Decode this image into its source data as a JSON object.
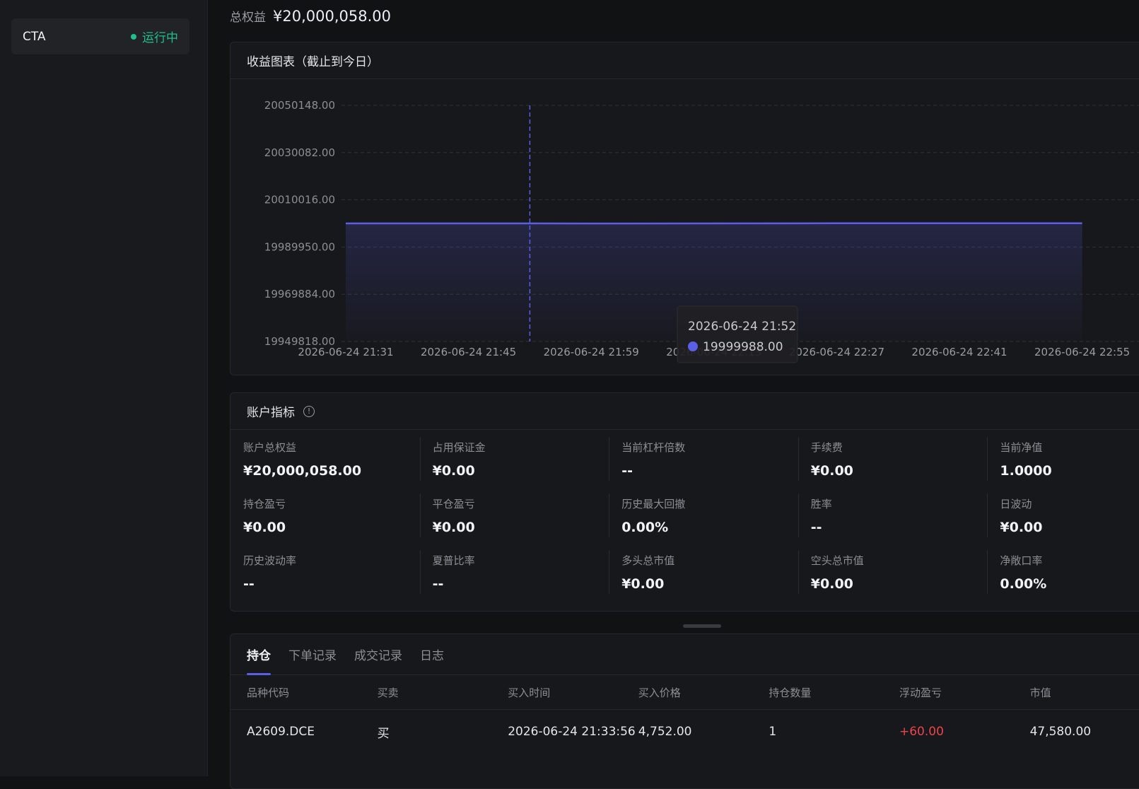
{
  "sidebar": {
    "strategy": {
      "name": "CTA",
      "status": "运行中",
      "status_color": "#1fbf8f"
    }
  },
  "header": {
    "equity_label": "总权益",
    "equity_value": "¥20,000,058.00"
  },
  "chart_card": {
    "title": "收益图表（截止到今日）",
    "chart_data": {
      "type": "area",
      "x": [
        "2026-06-24 21:31",
        "2026-06-24 21:45",
        "2026-06-24 21:59",
        "2026-06-24 22:13",
        "2026-06-24 22:27",
        "2026-06-24 22:41",
        "2026-06-24 22:55"
      ],
      "y_ticks": [
        "20050148.00",
        "20030082.00",
        "20010016.00",
        "19989950.00",
        "19969884.00",
        "19949818.00"
      ],
      "ylim": [
        19949818.0,
        20050148.0
      ],
      "series": [
        {
          "values": [
            19999988.0,
            19999988.0,
            19999960.0,
            19999988.0,
            20000030.0,
            20000058.0,
            20000058.0
          ]
        }
      ],
      "line_color": "#5b5ee6",
      "grid": true,
      "tooltip": {
        "time": "2026-06-24 21:52",
        "value": "19999988.00"
      },
      "cursor_x": "2026-06-24 21:52"
    }
  },
  "metrics_card": {
    "title": "账户指标",
    "info_icon": "!",
    "items": [
      {
        "label": "账户总权益",
        "value": "¥20,000,058.00"
      },
      {
        "label": "占用保证金",
        "value": "¥0.00"
      },
      {
        "label": "当前杠杆倍数",
        "value": "--"
      },
      {
        "label": "手续费",
        "value": "¥0.00"
      },
      {
        "label": "当前净值",
        "value": "1.0000"
      },
      {
        "label": "持仓盈亏",
        "value": "¥0.00"
      },
      {
        "label": "平仓盈亏",
        "value": "¥0.00"
      },
      {
        "label": "历史最大回撤",
        "value": "0.00%"
      },
      {
        "label": "胜率",
        "value": "--"
      },
      {
        "label": "日波动",
        "value": "¥0.00"
      },
      {
        "label": "历史波动率",
        "value": "--"
      },
      {
        "label": "夏普比率",
        "value": "--"
      },
      {
        "label": "多头总市值",
        "value": "¥0.00"
      },
      {
        "label": "空头总市值",
        "value": "¥0.00"
      },
      {
        "label": "净敞口率",
        "value": "0.00%"
      }
    ]
  },
  "bottom_panel": {
    "tabs": [
      {
        "label": "持仓"
      },
      {
        "label": "下单记录"
      },
      {
        "label": "成交记录"
      },
      {
        "label": "日志"
      }
    ],
    "columns": [
      "品种代码",
      "买卖",
      "买入时间",
      "买入价格",
      "持仓数量",
      "浮动盈亏",
      "市值"
    ],
    "rows": [
      [
        "A2609.DCE",
        "买",
        "2026-06-24 21:33:56",
        "4,752.00",
        "1",
        "+60.00",
        "47,580.00"
      ]
    ],
    "pnl_positive_color": "#e8464a"
  }
}
